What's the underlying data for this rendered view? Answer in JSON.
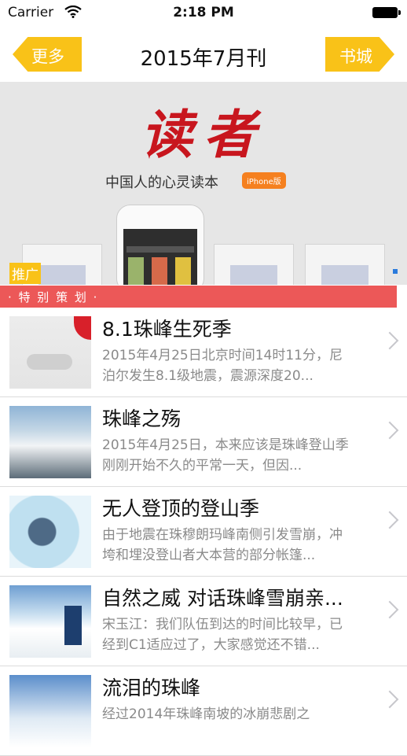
{
  "status_bar": {
    "carrier": "Carrier",
    "time": "2:18 PM"
  },
  "nav": {
    "back_label": "更多",
    "title": "2015年7月刊",
    "store_label": "书城"
  },
  "banner": {
    "logo": "读者",
    "slogan": "中国人的心灵读本",
    "badge": "iPhone版",
    "promo_tag": "推广"
  },
  "section": {
    "header": "· 特 别 策 划 ·"
  },
  "articles": [
    {
      "title": "8.1珠峰生死季",
      "desc": "2015年4月25日北京时间14时11分，尼泊尔发生8.1级地震，震源深度20..."
    },
    {
      "title": "珠峰之殇",
      "desc": "2015年4月25日，本来应该是珠峰登山季刚刚开始不久的平常一天，但因..."
    },
    {
      "title": "无人登顶的登山季",
      "desc": "由于地震在珠穆朗玛峰南侧引发雪崩，冲垮和埋没登山者大本营的部分帐篷..."
    },
    {
      "title": "自然之威 对话珠峰雪崩亲...",
      "desc": "宋玉江：我们队伍到达的时间比较早，已经到C1适应过了，大家感觉还不错..."
    },
    {
      "title": "流泪的珠峰",
      "desc": "经过2014年珠峰南坡的冰崩悲剧之"
    }
  ]
}
